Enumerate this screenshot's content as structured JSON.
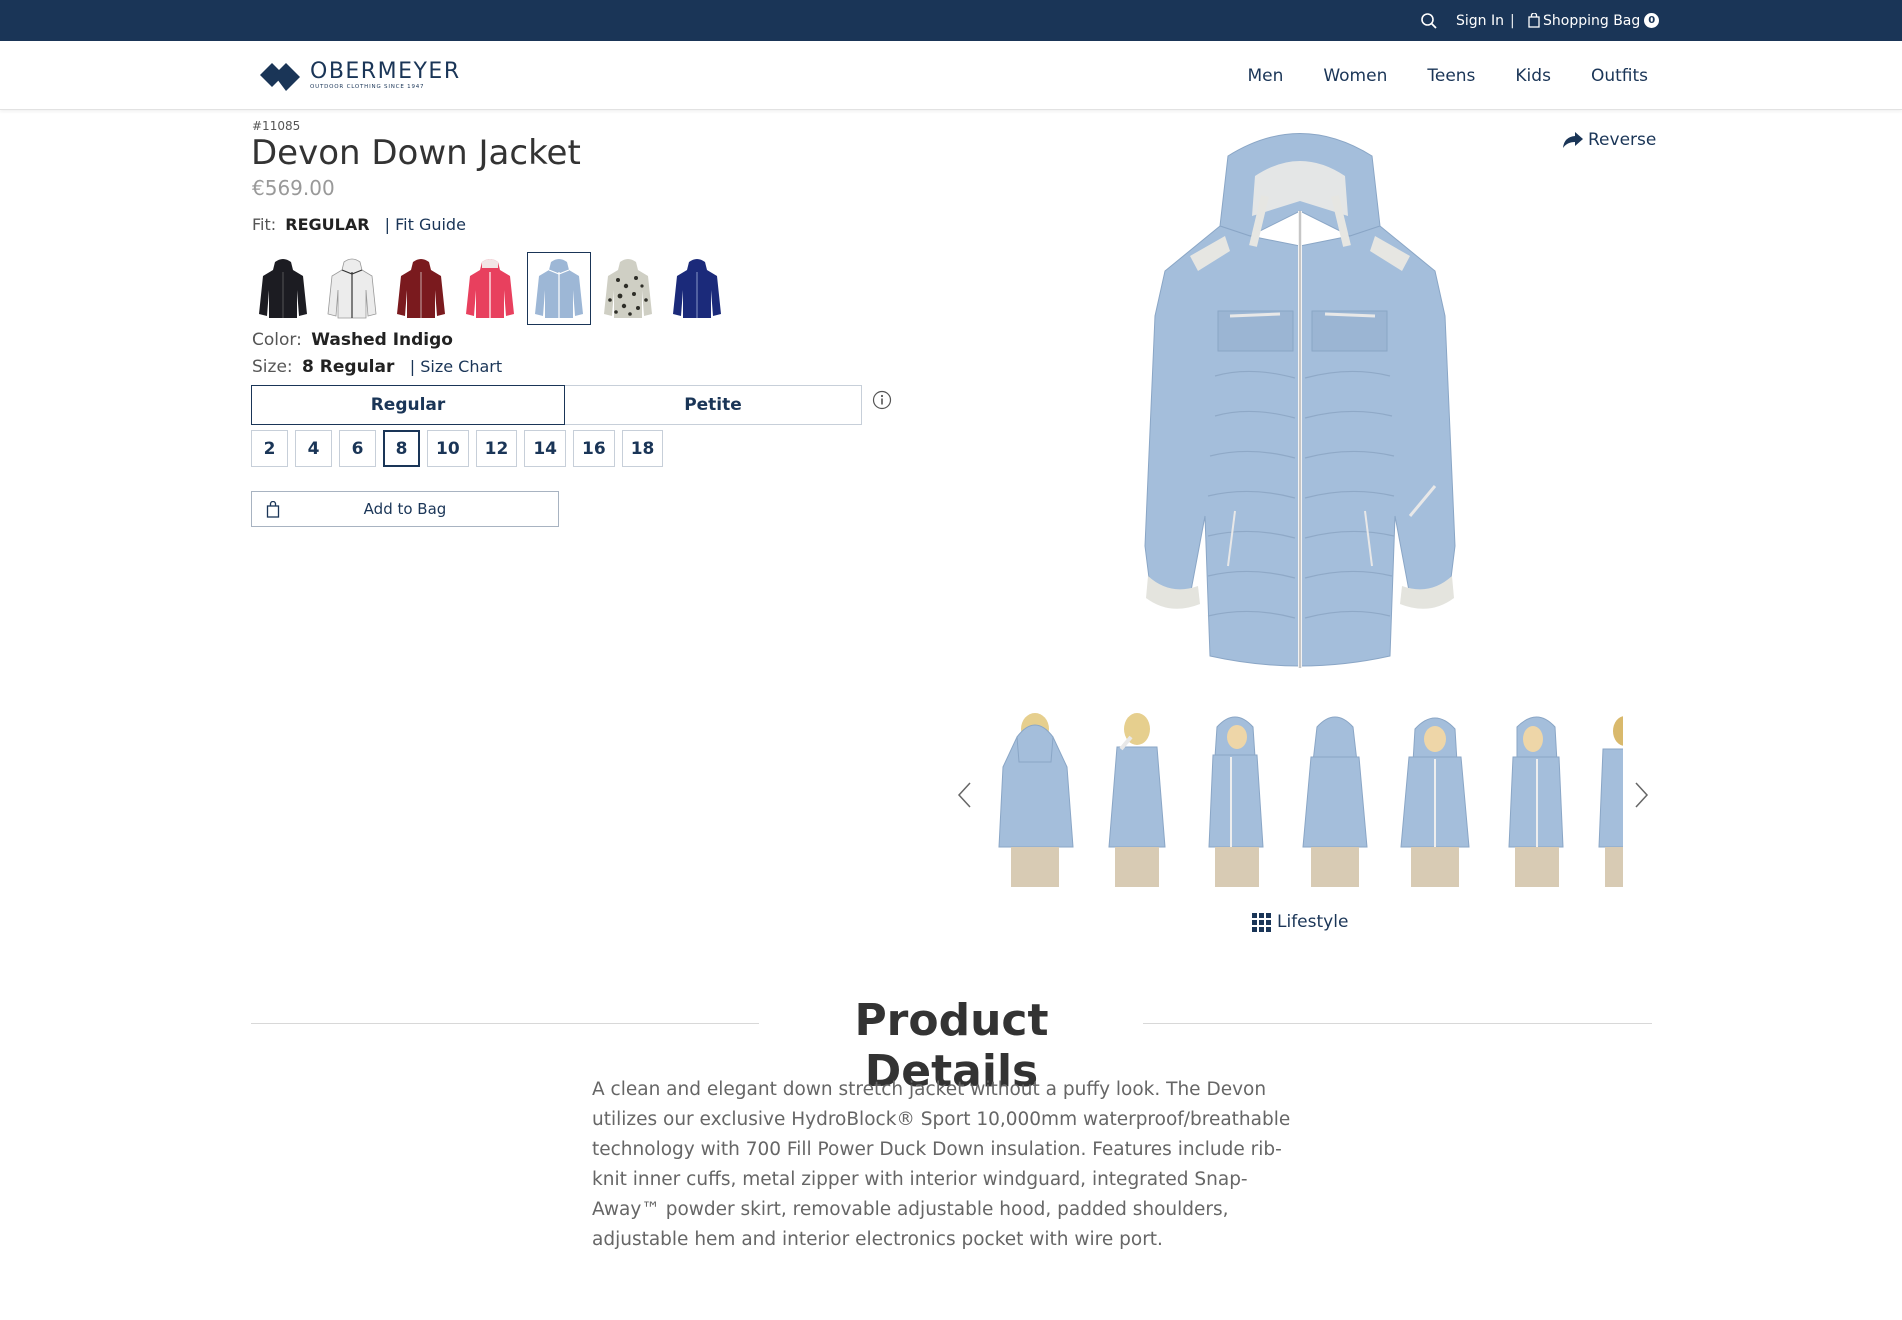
{
  "topbar": {
    "sign_in": "Sign In",
    "separator": "|",
    "shopping_bag": "Shopping Bag",
    "bag_count": "0"
  },
  "header": {
    "logo_name": "OBERMEYER",
    "logo_tagline": "OUTDOOR CLOTHING SINCE 1947",
    "nav": [
      "Men",
      "Women",
      "Teens",
      "Kids",
      "Outfits"
    ]
  },
  "product": {
    "sku": "#11085",
    "name": "Devon Down Jacket",
    "price": "€569.00",
    "fit_label": "Fit:",
    "fit_value": "REGULAR",
    "fit_guide": "| Fit Guide",
    "color_label": "Color:",
    "color_value": "Washed Indigo",
    "size_label": "Size:",
    "size_value": "8 Regular",
    "size_chart": "| Size Chart",
    "fit_options": [
      "Regular",
      "Petite"
    ],
    "sizes": [
      "2",
      "4",
      "6",
      "8",
      "10",
      "12",
      "14",
      "16",
      "18"
    ],
    "selected_size": "8",
    "add_to_bag": "Add to Bag",
    "swatch_colors": [
      "#1c1c22",
      "#e8e8e8",
      "#7a1a1e",
      "#e8405e",
      "#9db7d6",
      "#4a4a40",
      "#1b2a7a"
    ],
    "selected_swatch": "Washed Indigo"
  },
  "gallery": {
    "reverse_label": "Reverse",
    "lifestyle_label": "Lifestyle",
    "jacket_color": "#a4bedb"
  },
  "details": {
    "title": "Product Details",
    "description": "A clean and elegant down stretch jacket without a puffy look. The Devon utilizes our exclusive HydroBlock® Sport 10,000mm waterproof/breathable technology with 700 Fill Power Duck Down insulation. Features include rib-knit inner cuffs, metal zipper with interior windguard, integrated Snap-Away™ powder skirt, removable adjustable hood, padded shoulders, adjustable hem and interior electronics pocket with wire port."
  },
  "colors": {
    "navy": "#1a3557",
    "selected_border": "#1a3557"
  }
}
